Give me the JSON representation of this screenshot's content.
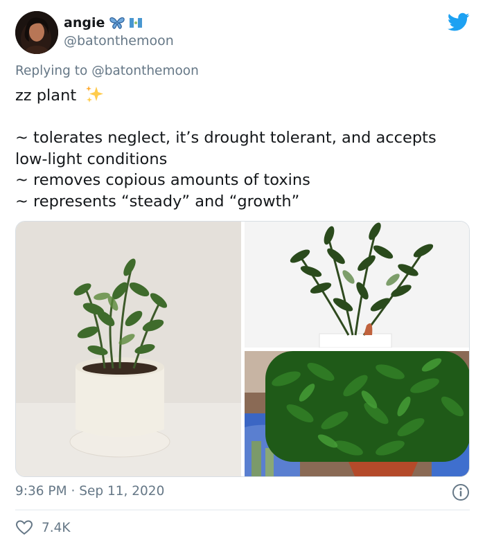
{
  "user": {
    "display_name": "angie",
    "handle": "@batonthemoon",
    "badge_icons": [
      "butterfly-icon",
      "guatemala-flag-icon"
    ]
  },
  "reply": {
    "prefix": "Replying to",
    "to_handle": "@batonthemoon"
  },
  "tweet": {
    "lines": [
      "zz plant",
      "",
      "~ tolerates neglect, it’s drought tolerant, and accepts",
      "low-light conditions",
      "~ removes copious amounts of toxins",
      "~ represents “steady” and “growth”"
    ],
    "emoji": "sparkles-icon"
  },
  "meta": {
    "time": "9:36 PM",
    "separator": "·",
    "date": "Sep 11, 2020"
  },
  "stats": {
    "likes": "7.4K"
  },
  "colors": {
    "brand": "#1da1f2",
    "secondary_text": "#657786",
    "text": "#14171a"
  }
}
